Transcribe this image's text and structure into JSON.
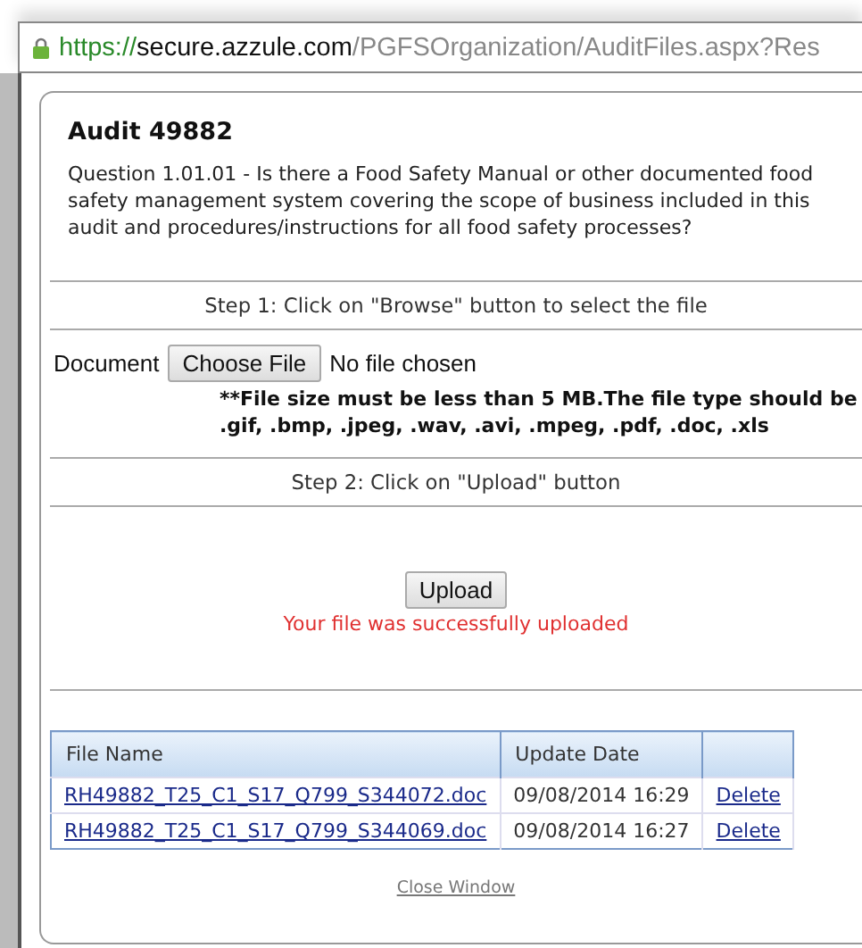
{
  "address_bar": {
    "scheme": "https://",
    "host": "secure.azzule.com",
    "path": "/PGFSOrganization/AuditFiles.aspx?Res"
  },
  "title": "Audit 49882",
  "question": "Question 1.01.01 - Is there a Food Safety Manual or other documented food safety management system covering the scope of business included in this audit and procedures/instructions for all food safety processes?",
  "step1": "Step 1: Click on \"Browse\" button to select the file",
  "document": {
    "label": "Document",
    "button": "Choose File",
    "status": "No file chosen"
  },
  "note": "**File size must be less than 5 MB.The file type should be .gif, .bmp, .jpeg, .wav, .avi, .mpeg, .pdf, .doc, .xls",
  "step2": "Step 2: Click on \"Upload\" button",
  "upload_button": "Upload",
  "message": "Your file was successfully uploaded",
  "table": {
    "columns": [
      "File Name",
      "Update Date"
    ],
    "rows": [
      {
        "file": "RH49882_T25_C1_S17_Q799_S344072.doc",
        "date": "09/08/2014 16:29",
        "action": "Delete"
      },
      {
        "file": "RH49882_T25_C1_S17_Q799_S344069.doc",
        "date": "09/08/2014 16:27",
        "action": "Delete"
      }
    ]
  },
  "close_link": "Close Window"
}
